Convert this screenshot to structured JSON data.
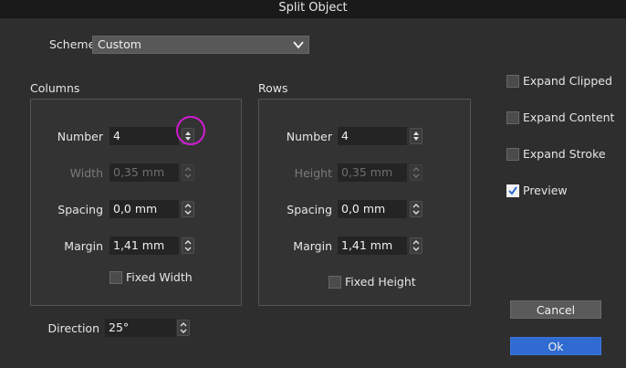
{
  "window": {
    "title": "Split Object"
  },
  "scheme": {
    "label": "Scheme",
    "value": "Custom"
  },
  "columns": {
    "title": "Columns",
    "number": {
      "label": "Number",
      "value": "4"
    },
    "width": {
      "label": "Width",
      "value": "0,35 mm"
    },
    "spacing": {
      "label": "Spacing",
      "value": "0,0 mm"
    },
    "margin": {
      "label": "Margin",
      "value": "1,41 mm"
    },
    "fixed": {
      "label": "Fixed Width",
      "checked": false
    }
  },
  "rows": {
    "title": "Rows",
    "number": {
      "label": "Number",
      "value": "4"
    },
    "height": {
      "label": "Height",
      "value": "0,35 mm"
    },
    "spacing": {
      "label": "Spacing",
      "value": "0,0 mm"
    },
    "margin": {
      "label": "Margin",
      "value": "1,41 mm"
    },
    "fixed": {
      "label": "Fixed Height",
      "checked": false
    }
  },
  "direction": {
    "label": "Direction",
    "value": "25°"
  },
  "options": {
    "expand_clipped": {
      "label": "Expand Clipped",
      "checked": false
    },
    "expand_content": {
      "label": "Expand Content",
      "checked": false
    },
    "expand_stroke": {
      "label": "Expand Stroke",
      "checked": false
    },
    "preview": {
      "label": "Preview",
      "checked": true
    }
  },
  "buttons": {
    "cancel": "Cancel",
    "ok": "Ok"
  },
  "colors": {
    "accent": "#2f6bd0",
    "highlight_ring": "#d21cd2"
  }
}
